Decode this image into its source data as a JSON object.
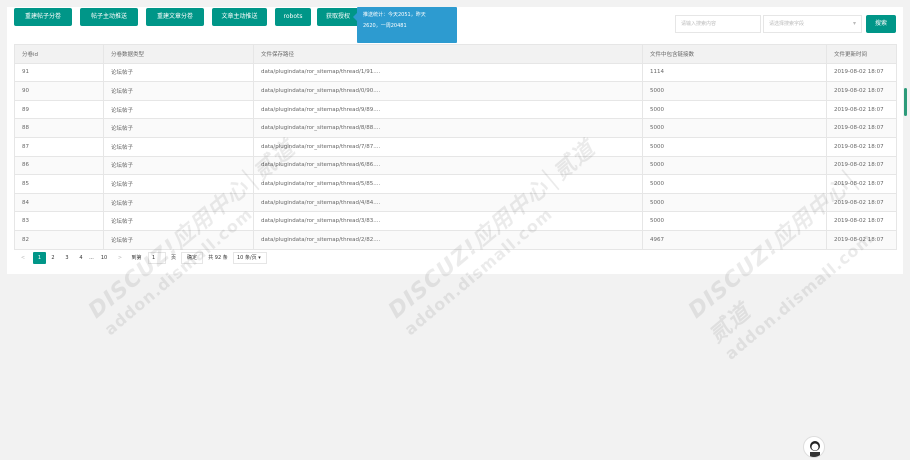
{
  "toolbar": {
    "buttons": [
      {
        "label": "重建帖子分卷"
      },
      {
        "label": "帖子主动推送"
      },
      {
        "label": "重建文章分卷"
      },
      {
        "label": "文章主动推送"
      },
      {
        "label": "robots"
      },
      {
        "label": "获取授权"
      }
    ]
  },
  "tooltip": {
    "line1": "推送统计：今天2051，昨天",
    "line2": "2620，一周20481"
  },
  "search": {
    "placeholder": "请输入搜索内容",
    "field_placeholder": "请选择搜索字段",
    "button_label": "搜索"
  },
  "table": {
    "columns": [
      "分卷id",
      "分卷数据类型",
      "文件保存路径",
      "文件中包含链接数",
      "文件更新时间"
    ],
    "rows": [
      [
        "91",
        "论坛帖子",
        "data/plugindata/ror_sitemap/thread/1/91....",
        "1114",
        "2019-08-02 18:07"
      ],
      [
        "90",
        "论坛帖子",
        "data/plugindata/ror_sitemap/thread/0/90....",
        "5000",
        "2019-08-02 18:07"
      ],
      [
        "89",
        "论坛帖子",
        "data/plugindata/ror_sitemap/thread/9/89....",
        "5000",
        "2019-08-02 18:07"
      ],
      [
        "88",
        "论坛帖子",
        "data/plugindata/ror_sitemap/thread/8/88....",
        "5000",
        "2019-08-02 18:07"
      ],
      [
        "87",
        "论坛帖子",
        "data/plugindata/ror_sitemap/thread/7/87....",
        "5000",
        "2019-08-02 18:07"
      ],
      [
        "86",
        "论坛帖子",
        "data/plugindata/ror_sitemap/thread/6/86....",
        "5000",
        "2019-08-02 18:07"
      ],
      [
        "85",
        "论坛帖子",
        "data/plugindata/ror_sitemap/thread/5/85....",
        "5000",
        "2019-08-02 18:07"
      ],
      [
        "84",
        "论坛帖子",
        "data/plugindata/ror_sitemap/thread/4/84....",
        "5000",
        "2019-08-02 18:07"
      ],
      [
        "83",
        "论坛帖子",
        "data/plugindata/ror_sitemap/thread/3/83....",
        "5000",
        "2019-08-02 18:07"
      ],
      [
        "82",
        "论坛帖子",
        "data/plugindata/ror_sitemap/thread/2/82....",
        "4967",
        "2019-08-02 18:07"
      ]
    ]
  },
  "pager": {
    "prev": "<",
    "pages": [
      "1",
      "2",
      "3",
      "4"
    ],
    "ellipsis": "...",
    "last": "10",
    "next": ">",
    "goto_label": "到第",
    "goto_value": "1",
    "page_unit": "页",
    "confirm": "确定",
    "total": "共 92 条",
    "limit": "10 条/页"
  },
  "watermark": {
    "line1": "DISCUZ!应用中心│贰道",
    "line2": "addon.dismall.com",
    "mark": "®"
  },
  "colors": {
    "primary": "#009688",
    "tooltip": "#2d9bd0"
  }
}
